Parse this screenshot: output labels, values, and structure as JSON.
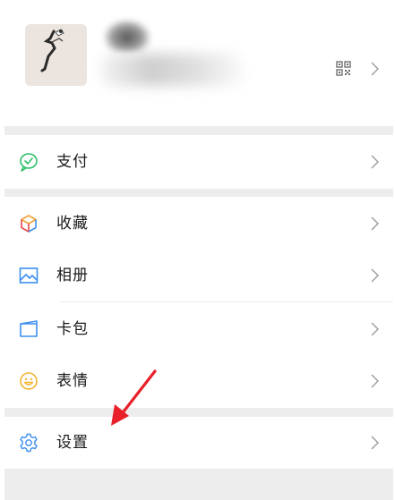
{
  "profile": {
    "qr_icon": "qr-code-icon",
    "chevron_icon": "chevron-right-icon"
  },
  "menu": [
    {
      "label": "支付",
      "icon": "pay-icon"
    },
    {
      "label": "收藏",
      "icon": "favorites-cube-icon"
    },
    {
      "label": "相册",
      "icon": "album-icon"
    },
    {
      "label": "卡包",
      "icon": "card-wallet-icon"
    },
    {
      "label": "表情",
      "icon": "smiley-icon"
    },
    {
      "label": "设置",
      "icon": "gear-icon"
    }
  ],
  "colors": {
    "pay_green": "#2bbf6a",
    "accent_red": "#e8202a",
    "gap_gray": "#ededed"
  }
}
